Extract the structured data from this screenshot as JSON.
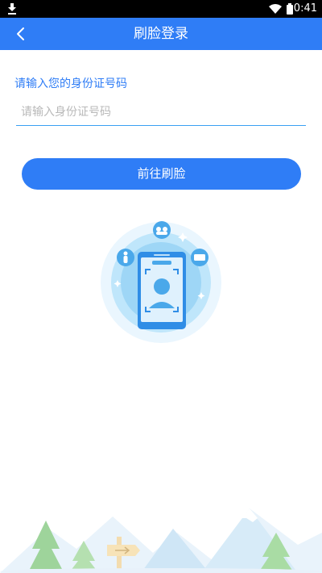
{
  "status_bar": {
    "time": "10:41"
  },
  "header": {
    "title": "刷脸登录"
  },
  "form": {
    "label": "请输入您的身份证号码",
    "id_input_placeholder": "请输入身份证号码",
    "id_input_value": ""
  },
  "action": {
    "button_label": "前往刷脸"
  },
  "colors": {
    "primary": "#2f7df6",
    "input_underline": "#3aa0f3",
    "illustration_light": "#bfe6fb",
    "illustration_mid": "#5fb6ec"
  },
  "icons": [
    "download-icon",
    "wifi-icon",
    "battery-icon",
    "back-arrow-icon",
    "face-scan-illustration",
    "scenery-illustration"
  ]
}
